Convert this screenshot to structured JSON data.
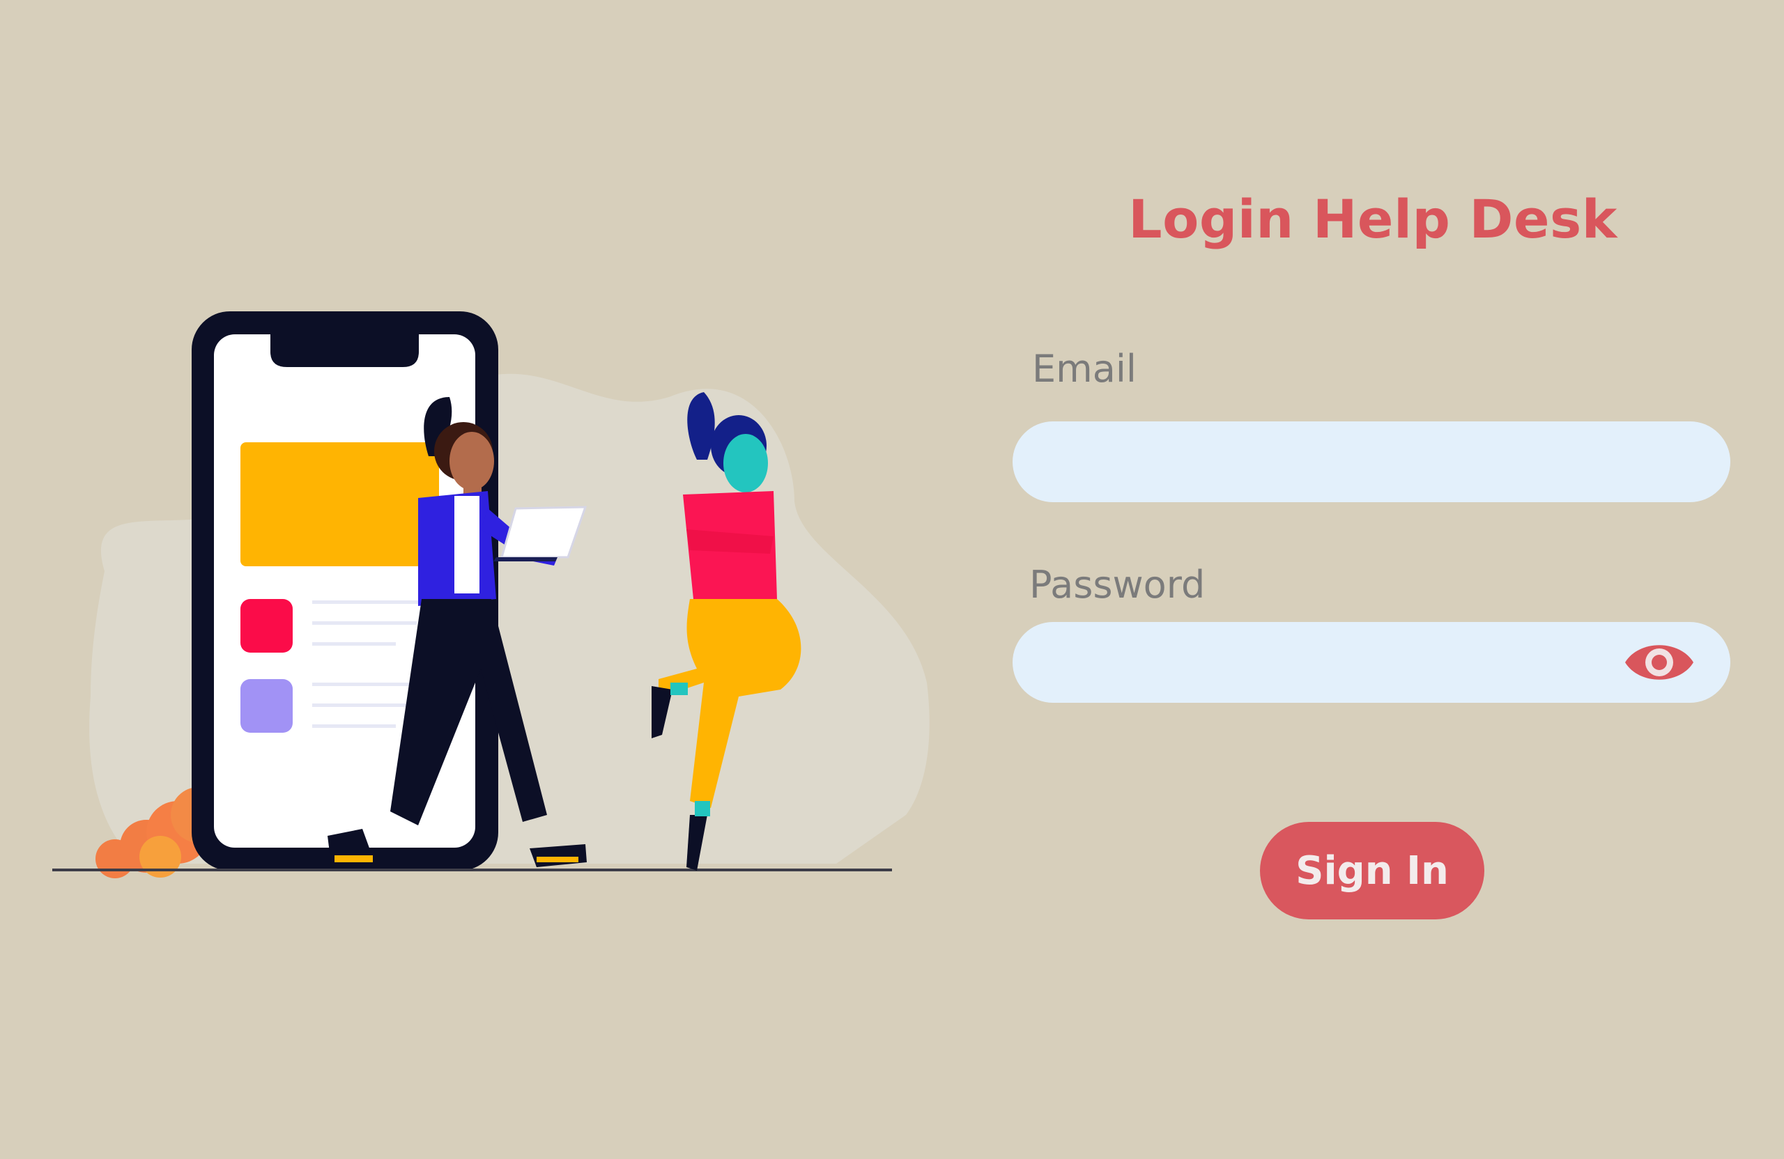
{
  "login": {
    "title": "Login Help Desk",
    "email_label": "Email",
    "email_value": "",
    "password_label": "Password",
    "password_value": "",
    "signin_label": "Sign In"
  },
  "icons": {
    "password_toggle": "eye-icon"
  },
  "colors": {
    "background": "#d7cfbb",
    "accent": "#d9565c",
    "input_bg": "#e3f0fb",
    "label": "#7b7b7b"
  }
}
